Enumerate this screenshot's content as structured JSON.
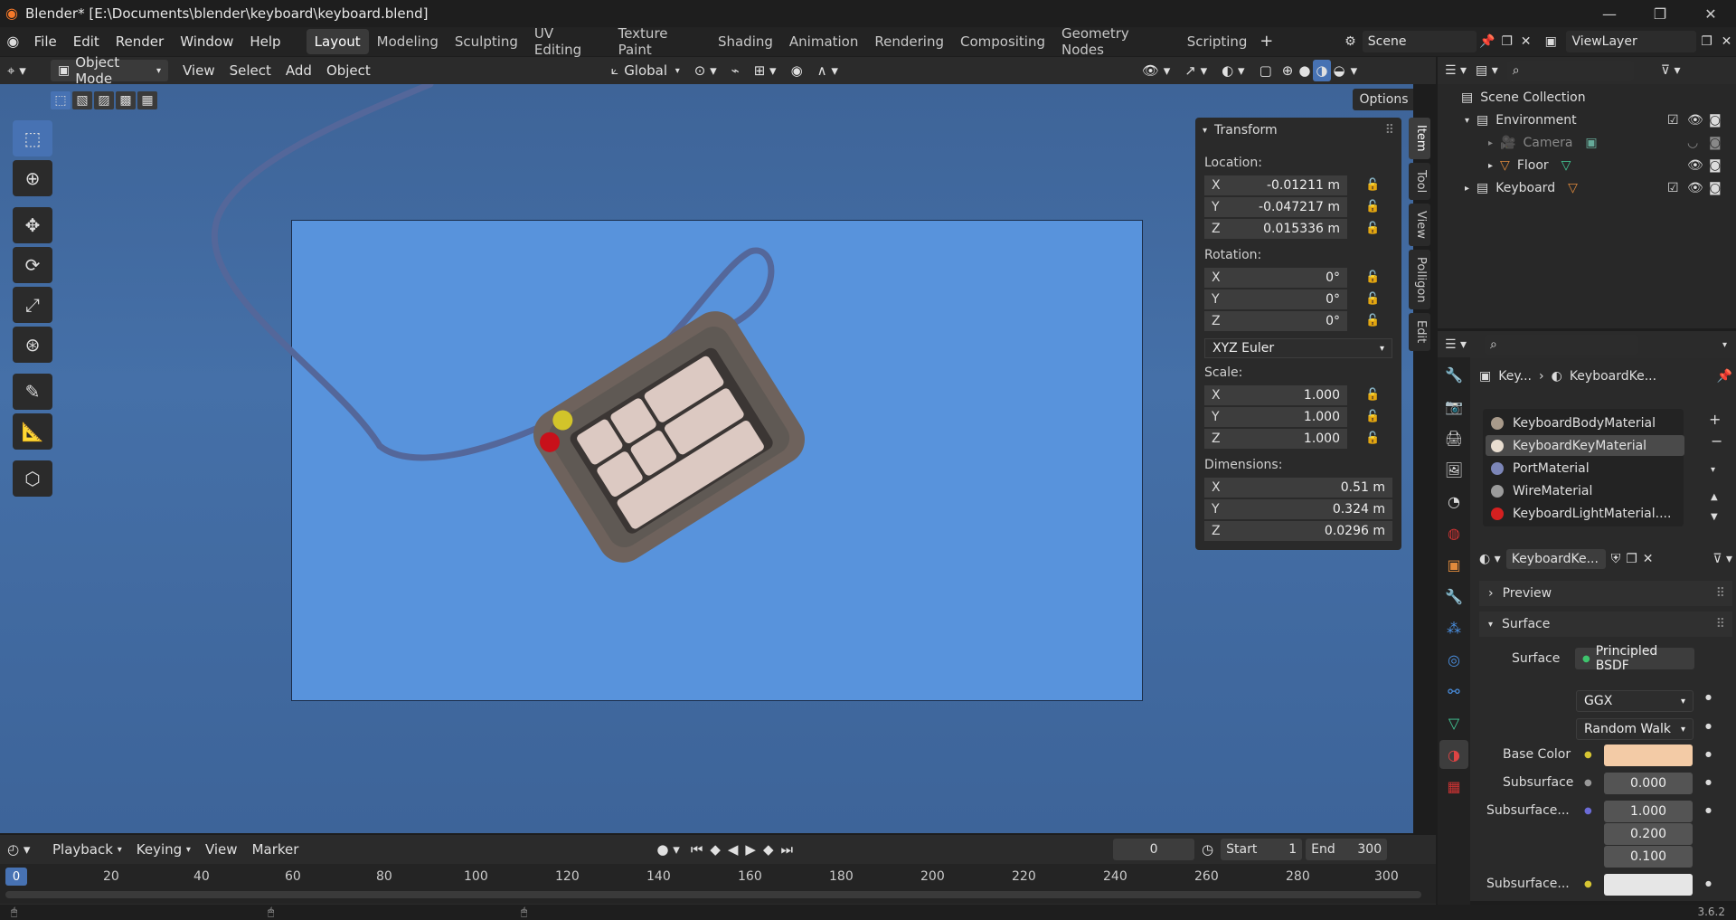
{
  "window": {
    "title": "Blender* [E:\\Documents\\blender\\keyboard\\keyboard.blend]"
  },
  "menu": [
    "File",
    "Edit",
    "Render",
    "Window",
    "Help"
  ],
  "workspaces": [
    "Layout",
    "Modeling",
    "Sculpting",
    "UV Editing",
    "Texture Paint",
    "Shading",
    "Animation",
    "Rendering",
    "Compositing",
    "Geometry Nodes",
    "Scripting"
  ],
  "active_workspace": "Layout",
  "scene": "Scene",
  "view_layer": "ViewLayer",
  "viewport_header": {
    "mode": "Object Mode",
    "menus": [
      "View",
      "Select",
      "Add",
      "Object"
    ],
    "orientation": "Global",
    "options": "Options"
  },
  "transform": {
    "title": "Transform",
    "location_label": "Location:",
    "location": [
      {
        "axis": "X",
        "value": "-0.01211 m"
      },
      {
        "axis": "Y",
        "value": "-0.047217 m"
      },
      {
        "axis": "Z",
        "value": "0.015336 m"
      }
    ],
    "rotation_label": "Rotation:",
    "rotation": [
      {
        "axis": "X",
        "value": "0°"
      },
      {
        "axis": "Y",
        "value": "0°"
      },
      {
        "axis": "Z",
        "value": "0°"
      }
    ],
    "rotation_mode": "XYZ Euler",
    "scale_label": "Scale:",
    "scale": [
      {
        "axis": "X",
        "value": "1.000"
      },
      {
        "axis": "Y",
        "value": "1.000"
      },
      {
        "axis": "Z",
        "value": "1.000"
      }
    ],
    "dimensions_label": "Dimensions:",
    "dimensions": [
      {
        "axis": "X",
        "value": "0.51 m"
      },
      {
        "axis": "Y",
        "value": "0.324 m"
      },
      {
        "axis": "Z",
        "value": "0.0296 m"
      }
    ]
  },
  "side_tabs": [
    "Item",
    "Tool",
    "View",
    "Polligon",
    "Edit"
  ],
  "outliner": {
    "root": "Scene Collection",
    "items": [
      "Environment",
      "Camera",
      "Floor",
      "Keyboard"
    ]
  },
  "properties": {
    "breadcrumb_object": "Key...",
    "breadcrumb_material": "KeyboardKe...",
    "materials": [
      {
        "name": "KeyboardBodyMaterial",
        "color": "#a89a8a"
      },
      {
        "name": "KeyboardKeyMaterial",
        "color": "#e8ddd0"
      },
      {
        "name": "PortMaterial",
        "color": "#7c86b8"
      },
      {
        "name": "WireMaterial",
        "color": "#9b9b9b"
      },
      {
        "name": "KeyboardLightMaterial....",
        "color": "#d42020"
      }
    ],
    "active_material": "KeyboardKe...",
    "preview": "Preview",
    "surface": "Surface",
    "surface_label": "Surface",
    "shader": "Principled BSDF",
    "distribution": "GGX",
    "subsurface_method": "Random Walk",
    "base_color_label": "Base Color",
    "base_color": "#f3cba6",
    "subsurface_label": "Subsurface",
    "subsurface_value": "0.000",
    "subsurface_radius_label": "Subsurface...",
    "subsurface_radius": [
      "1.000",
      "0.200",
      "0.100"
    ],
    "subsurface_color_label": "Subsurface..."
  },
  "timeline": {
    "menus": [
      "Playback",
      "Keying",
      "View",
      "Marker"
    ],
    "current_frame": "0",
    "start_label": "Start",
    "start": "1",
    "end_label": "End",
    "end": "300",
    "ticks": [
      "0",
      "20",
      "40",
      "60",
      "80",
      "100",
      "120",
      "140",
      "160",
      "180",
      "200",
      "220",
      "240",
      "260",
      "280",
      "300"
    ]
  },
  "version": "3.6.2"
}
